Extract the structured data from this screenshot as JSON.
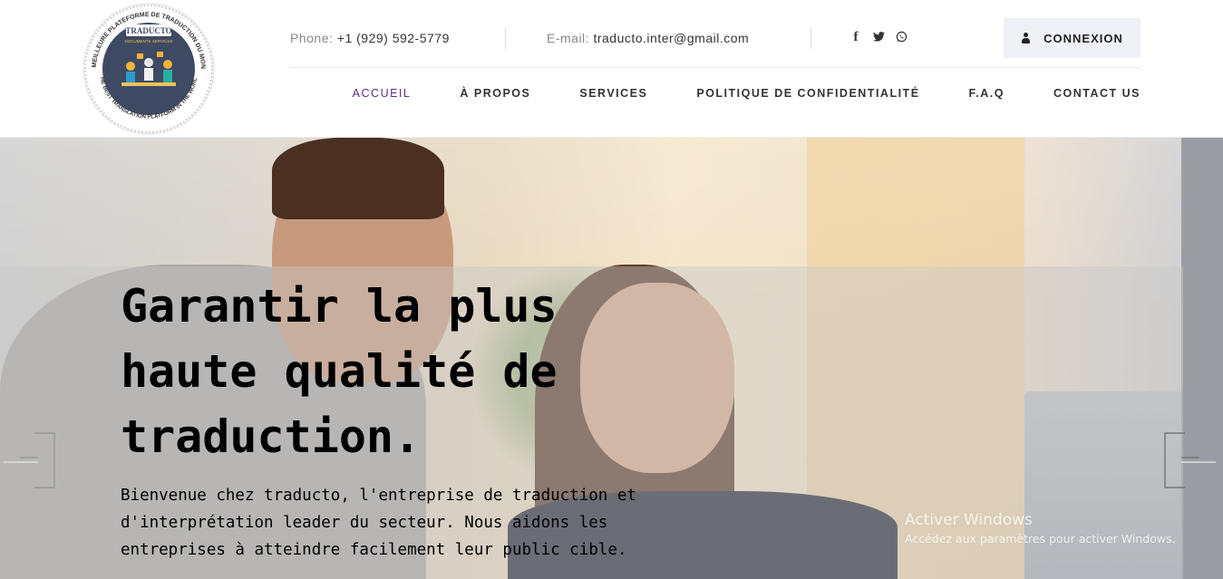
{
  "header": {
    "logo": {
      "ring_text_top": "LA MEILLEURE PLATEFORME DE TRADUCTION DU MONDE",
      "ring_text_bottom": "THE BEST TRANSLATION PLATFORM IN THE WORLD",
      "brand": "TRADUCTO",
      "tagline": "DOCUMENTS SERVICES"
    },
    "contact": {
      "phone_label": "Phone:",
      "phone_value": "+1 (929) 592-5779",
      "email_label": "E-mail:",
      "email_value": "traducto.inter@gmail.com"
    },
    "social_icons": [
      "facebook-icon",
      "twitter-icon",
      "whatsapp-icon"
    ],
    "social_glyphs": [
      "f",
      "🐦",
      "◌"
    ],
    "login_label": "CONNEXION",
    "nav": [
      {
        "label": "ACCUEIL",
        "active": true
      },
      {
        "label": "À PROPOS",
        "active": false
      },
      {
        "label": "SERVICES",
        "active": false
      },
      {
        "label": "POLITIQUE DE CONFIDENTIALITÉ",
        "active": false
      },
      {
        "label": "F.A.Q",
        "active": false
      },
      {
        "label": "CONTACT US",
        "active": false
      }
    ]
  },
  "hero": {
    "title": "Garantir la plus haute qualité de traduction.",
    "text": "Bienvenue chez traducto, l'entreprise de traduction et d'interprétation leader du secteur. Nous aidons les entreprises à atteindre facilement leur public cible."
  },
  "watermark": {
    "line1": "Activer Windows",
    "line2": "Accédez aux paramètres pour activer Windows."
  },
  "colors": {
    "accent": "#5b2c83",
    "login_bg": "#f0f1f7",
    "logo_navy": "#3e4a63"
  }
}
